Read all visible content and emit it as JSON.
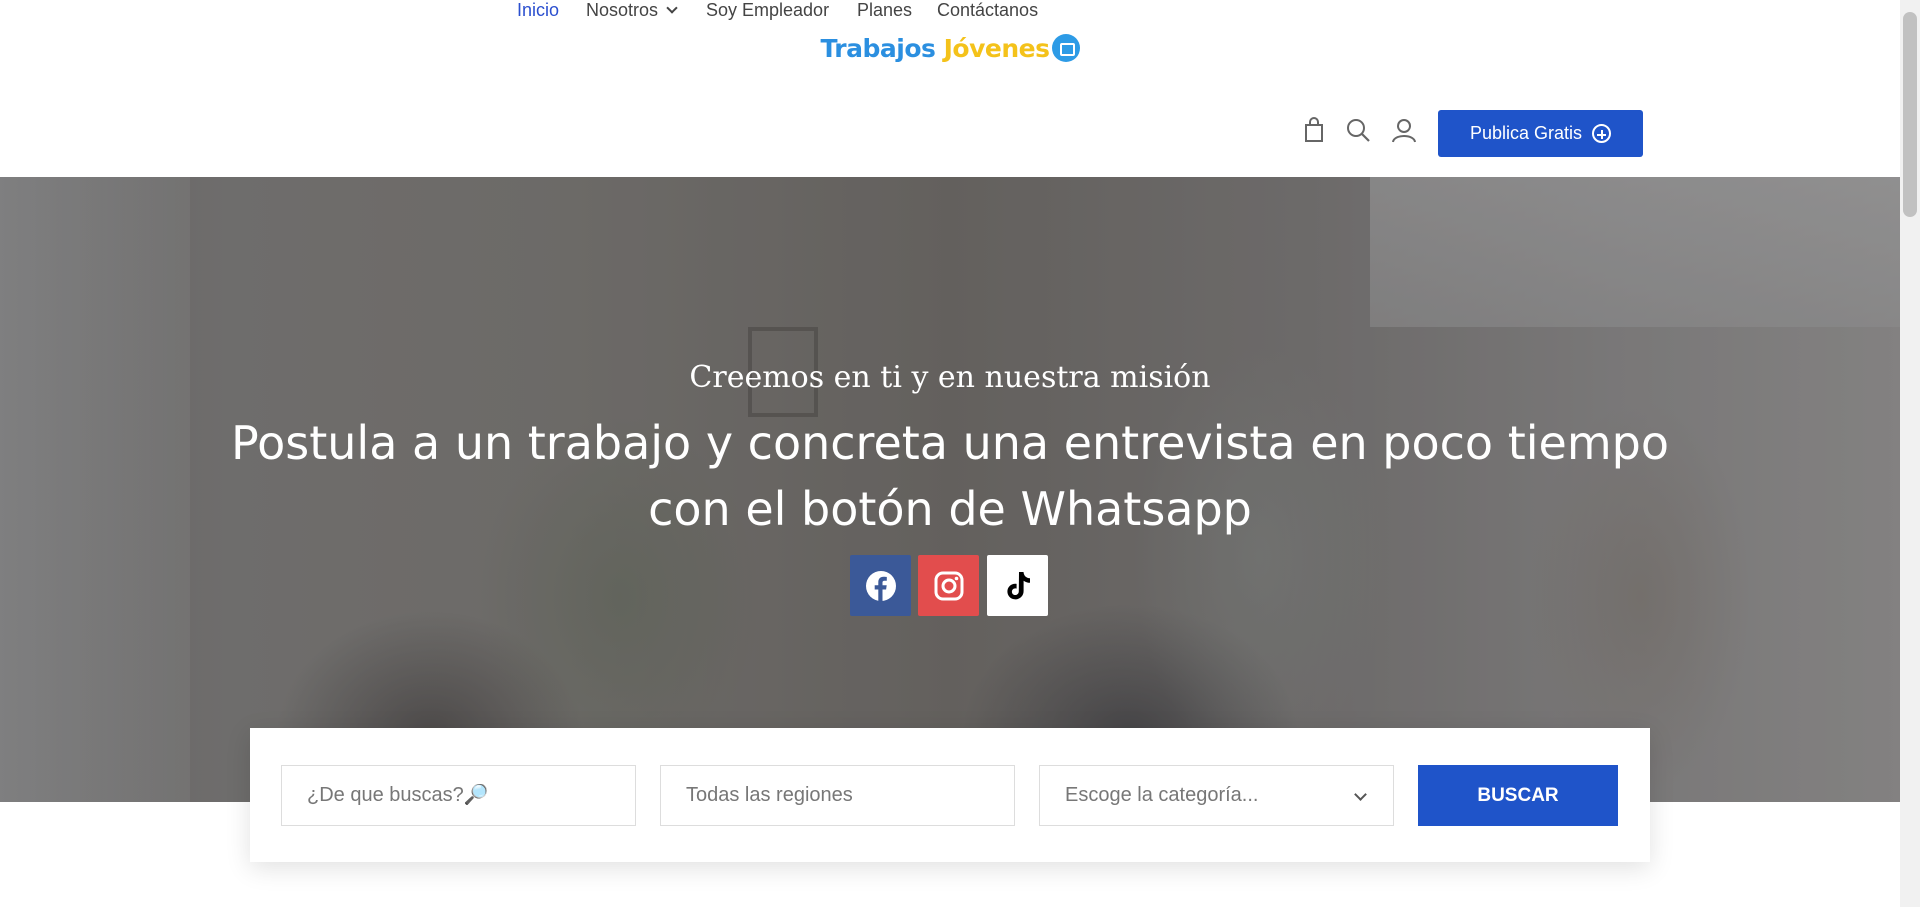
{
  "header": {
    "logo": {
      "word1": "Trabajos",
      "word2": "Jóvenes",
      "icon": "briefcase-badge-icon"
    },
    "nav": [
      {
        "label": "Inicio",
        "active": true
      },
      {
        "label": "Nosotros",
        "has_dropdown": true
      },
      {
        "label": "Soy Empleador"
      },
      {
        "label": "Planes"
      },
      {
        "label": "Contáctanos"
      }
    ],
    "icons": [
      "shopping-bag-icon",
      "search-icon",
      "user-icon"
    ],
    "publish_button": {
      "label": "Publica Gratis",
      "icon": "plus-circle-icon"
    }
  },
  "hero": {
    "subtitle": "Creemos en ti y en nuestra misión",
    "title": "Postula a un trabajo y concreta una entrevista en poco tiempo con el botón de Whatsapp",
    "social": [
      {
        "name": "facebook",
        "color": "#3b5998"
      },
      {
        "name": "instagram",
        "color": "#e24d4d"
      },
      {
        "name": "tiktok",
        "color": "#ffffff"
      }
    ]
  },
  "search": {
    "keyword_placeholder": "¿De que buscas?🔎",
    "region_placeholder": "Todas las regiones",
    "category_selected": "Escoge la categoría...",
    "button_label": "BUSCAR"
  },
  "colors": {
    "accent": "#1f54c9",
    "nav_active": "#2b4fcf",
    "logo_blue": "#2b8fe0",
    "logo_yellow": "#f4c21a"
  }
}
